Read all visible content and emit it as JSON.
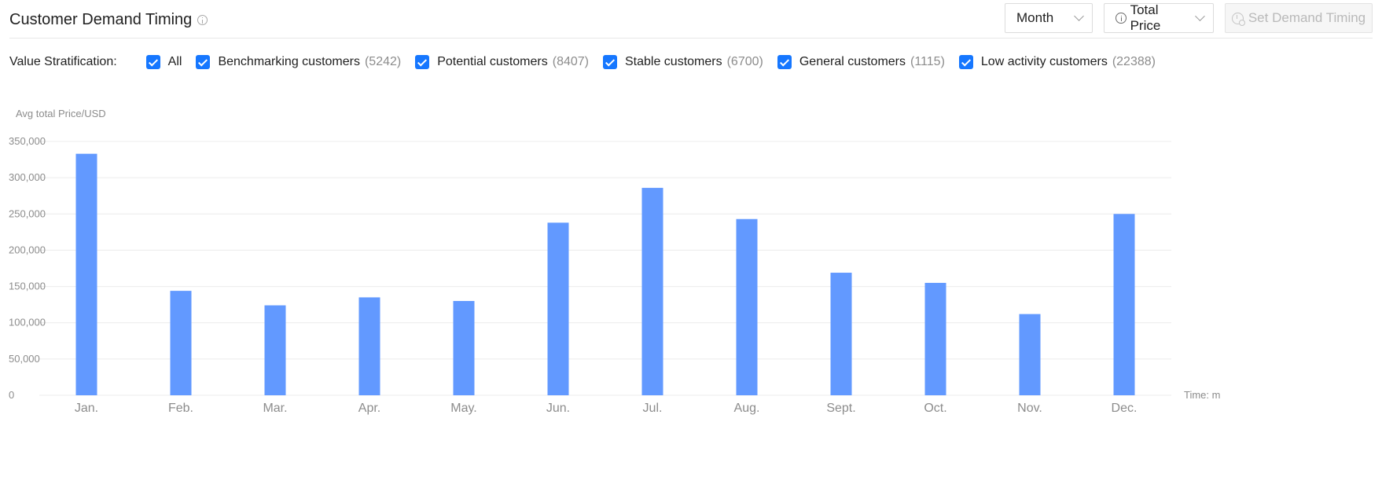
{
  "header": {
    "title": "Customer Demand Timing",
    "period_select": "Month",
    "metric_select": "Total Price",
    "set_button": "Set Demand Timing"
  },
  "filters": {
    "label": "Value Stratification:",
    "items": [
      {
        "label": "All",
        "count": "",
        "checked": true
      },
      {
        "label": "Benchmarking customers",
        "count": "(5242)",
        "checked": true
      },
      {
        "label": "Potential customers",
        "count": "(8407)",
        "checked": true
      },
      {
        "label": "Stable customers",
        "count": "(6700)",
        "checked": true
      },
      {
        "label": "General customers",
        "count": "(1115)",
        "checked": true
      },
      {
        "label": "Low activity customers",
        "count": "(22388)",
        "checked": true
      }
    ]
  },
  "colors": {
    "accent": "#1677ff",
    "bar": "#6299ff"
  },
  "chart_data": {
    "type": "bar",
    "ylabel": "Avg total Price/USD",
    "xlabel": "Time: m",
    "ylim": [
      0,
      350000
    ],
    "yticks": [
      0,
      50000,
      100000,
      150000,
      200000,
      250000,
      300000,
      350000
    ],
    "ytick_labels": [
      "0",
      "50,000",
      "100,000",
      "150,000",
      "200,000",
      "250,000",
      "300,000",
      "350,000"
    ],
    "grid": true,
    "categories": [
      "Jan.",
      "Feb.",
      "Mar.",
      "Apr.",
      "May.",
      "Jun.",
      "Jul.",
      "Aug.",
      "Sept.",
      "Oct.",
      "Nov.",
      "Dec."
    ],
    "values": [
      333000,
      144000,
      124000,
      135000,
      130000,
      238000,
      286000,
      243000,
      169000,
      155000,
      112000,
      250000
    ]
  }
}
